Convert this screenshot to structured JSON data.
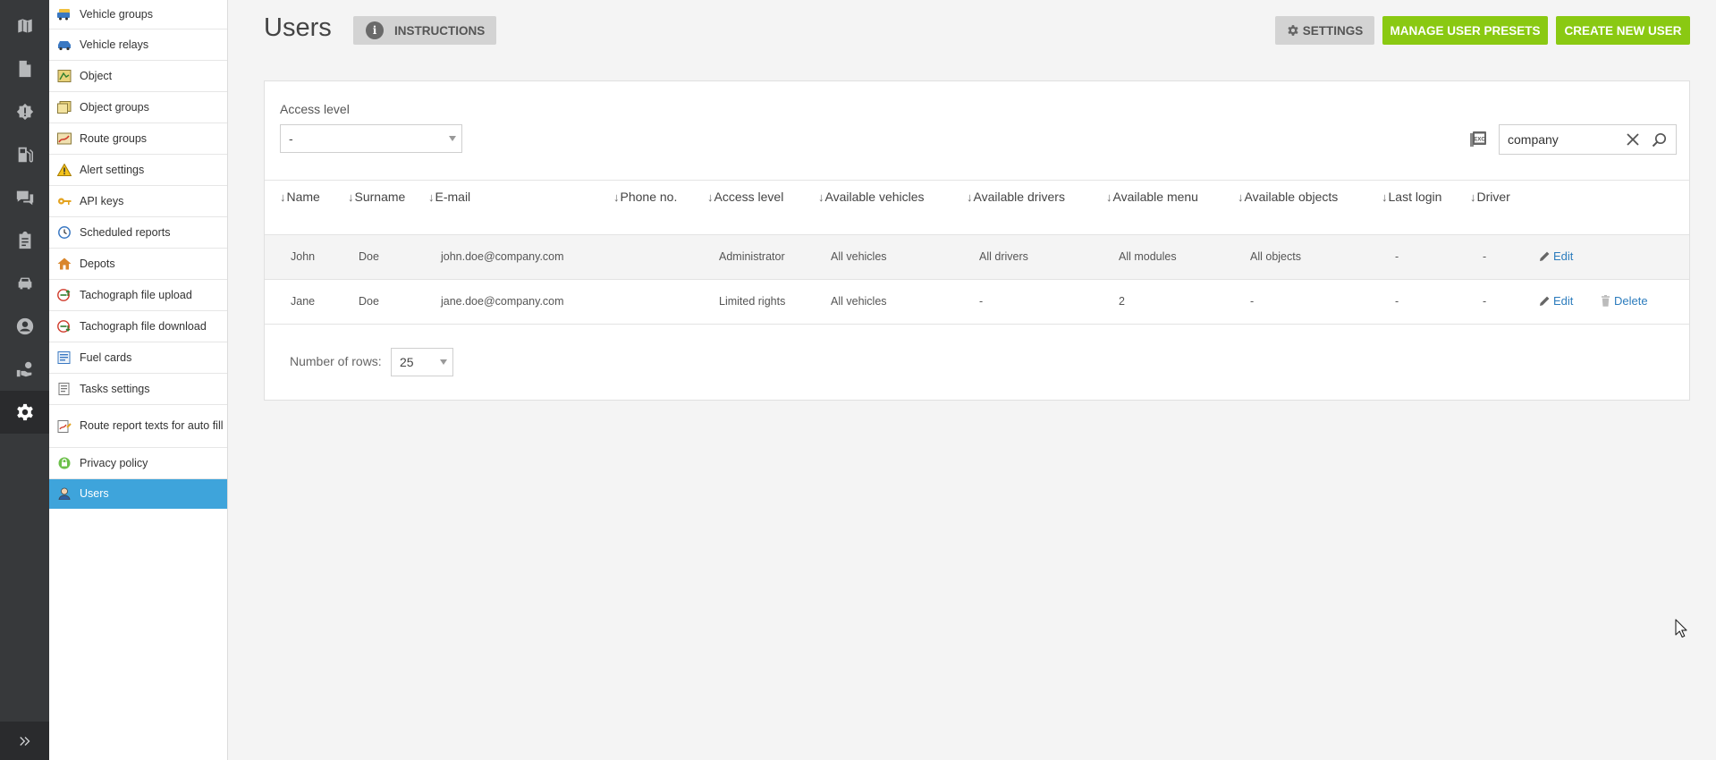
{
  "rail": {
    "icons": [
      "map-icon",
      "document-icon",
      "alert-icon",
      "fuel-icon",
      "chat-icon",
      "clipboard-icon",
      "car-icon",
      "user-circle-icon",
      "hand-coin-icon",
      "gear-icon"
    ],
    "expand_icon": "double-chevron-right-icon"
  },
  "menu": {
    "items": [
      {
        "label": "Vehicle groups",
        "icon": "vehicle-groups-icon"
      },
      {
        "label": "Vehicle relays",
        "icon": "vehicle-relays-icon"
      },
      {
        "label": "Object",
        "icon": "object-icon"
      },
      {
        "label": "Object groups",
        "icon": "object-groups-icon"
      },
      {
        "label": "Route groups",
        "icon": "route-groups-icon"
      },
      {
        "label": "Alert settings",
        "icon": "warning-icon"
      },
      {
        "label": "API keys",
        "icon": "key-icon"
      },
      {
        "label": "Scheduled reports",
        "icon": "clock-icon"
      },
      {
        "label": "Depots",
        "icon": "house-icon"
      },
      {
        "label": "Tachograph file upload",
        "icon": "tachograph-upload-icon"
      },
      {
        "label": "Tachograph file download",
        "icon": "tachograph-download-icon"
      },
      {
        "label": "Fuel cards",
        "icon": "fuel-card-icon"
      },
      {
        "label": "Tasks settings",
        "icon": "tasks-icon"
      },
      {
        "label": "Route report texts for auto fill",
        "icon": "route-report-icon"
      },
      {
        "label": "Privacy policy",
        "icon": "lock-icon"
      },
      {
        "label": "Users",
        "icon": "user-icon"
      }
    ]
  },
  "header": {
    "title": "Users",
    "instructions_label": "INSTRUCTIONS",
    "settings_label": "SETTINGS",
    "manage_presets_label": "MANAGE USER PRESETS",
    "create_user_label": "CREATE NEW USER"
  },
  "filters": {
    "access_level_label": "Access level",
    "access_level_value": "-",
    "search_value": "company"
  },
  "table": {
    "columns": [
      "Name",
      "Surname",
      "E-mail",
      "Phone no.",
      "Access level",
      "Available vehicles",
      "Available drivers",
      "Available menu",
      "Available objects",
      "Last login",
      "Driver"
    ],
    "rows": [
      {
        "name": "John",
        "surname": "Doe",
        "email": "john.doe@company.com",
        "phone": "",
        "access": "Administrator",
        "vehicles": "All vehicles",
        "drivers": "All drivers",
        "menu": "All modules",
        "objects": "All objects",
        "last_login": "-",
        "driver": "-",
        "edit": "Edit"
      },
      {
        "name": "Jane",
        "surname": "Doe",
        "email": "jane.doe@company.com",
        "phone": "",
        "access": "Limited rights",
        "vehicles": "All vehicles",
        "drivers": "-",
        "menu": "2",
        "objects": "-",
        "last_login": "-",
        "driver": "-",
        "edit": "Edit",
        "delete": "Delete"
      }
    ]
  },
  "pagination": {
    "rows_label": "Number of rows:",
    "rows_value": "25"
  },
  "colors": {
    "green": "#8ac912",
    "active_blue": "#3ea4db",
    "link": "#2c7cbd",
    "rail": "#37393b"
  }
}
